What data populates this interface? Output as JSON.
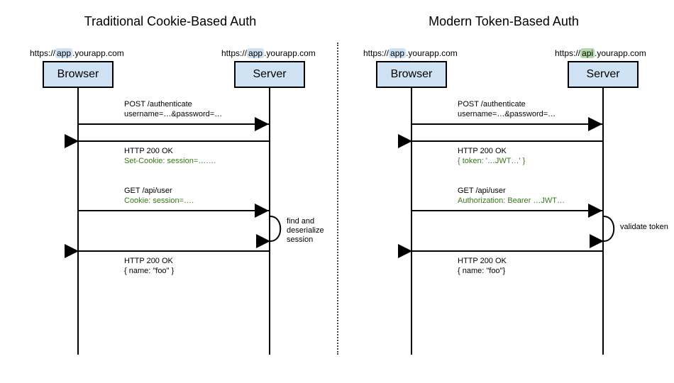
{
  "left": {
    "title": "Traditional Cookie-Based Auth",
    "browser_url": {
      "prefix": "https://",
      "highlight": "app",
      "suffix": ".yourapp.com",
      "hl": "blue"
    },
    "server_url": {
      "prefix": "https://",
      "highlight": "app",
      "suffix": ".yourapp.com",
      "hl": "blue"
    },
    "browser_label": "Browser",
    "server_label": "Server",
    "msgs": {
      "m1a": "POST /authenticate",
      "m1b": "username=…&password=…",
      "m2a": "HTTP 200 OK",
      "m2b": "Set-Cookie: session=…….",
      "m3a": "GET /api/user",
      "m3b": "Cookie: session=….",
      "m4a": "HTTP 200 OK",
      "m4b": "{  name: \"foo\" }"
    },
    "note": "find and\ndeserialize\nsession"
  },
  "right": {
    "title": "Modern Token-Based Auth",
    "browser_url": {
      "prefix": "https://",
      "highlight": "app",
      "suffix": ".yourapp.com",
      "hl": "blue"
    },
    "server_url": {
      "prefix": "https://",
      "highlight": "api",
      "suffix": ".yourapp.com",
      "hl": "green"
    },
    "browser_label": "Browser",
    "server_label": "Server",
    "msgs": {
      "m1a": "POST /authenticate",
      "m1b": "username=…&password=…",
      "m2a": "HTTP 200 OK",
      "m2b": "{ token: '…JWT…' }",
      "m3a": "GET /api/user",
      "m3b": "Authorization: Bearer …JWT…",
      "m4a": "HTTP 200 OK",
      "m4b": "{ name: \"foo\"}"
    },
    "note": "validate token"
  }
}
